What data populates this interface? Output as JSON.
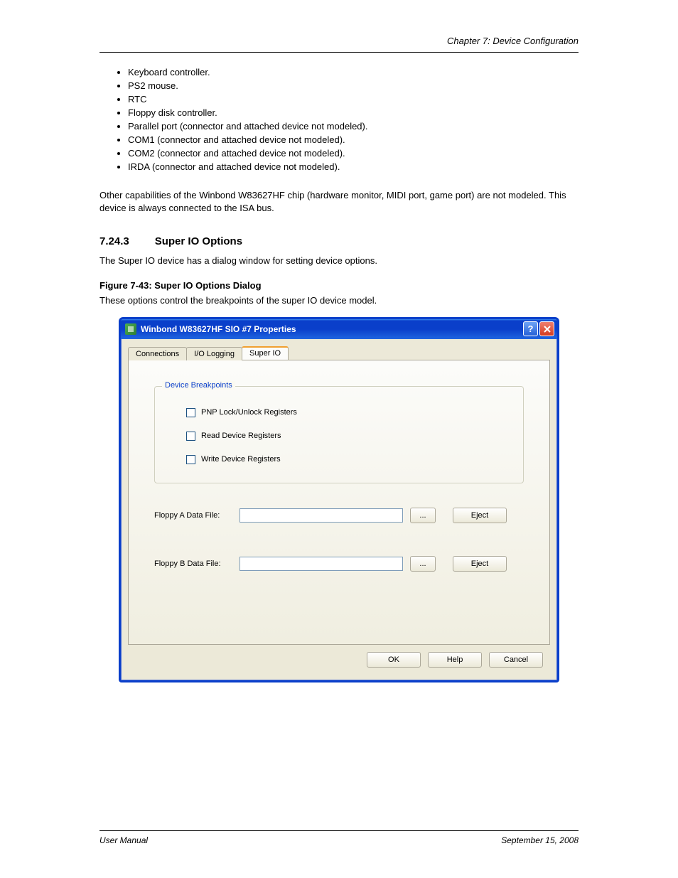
{
  "header_right": "Chapter 7: Device Configuration",
  "bullets": [
    "Keyboard controller.",
    "PS2 mouse.",
    "RTC",
    "Floppy disk controller.",
    "Parallel port (connector and attached device not modeled).",
    "COM1 (connector and attached device not modeled).",
    "COM2 (connector and attached device not modeled).",
    "IRDA (connector and attached device not modeled)."
  ],
  "paragraph1": "Other capabilities of the Winbond W83627HF chip (hardware monitor, MIDI port, game port) are not modeled. This device is always connected to the ISA bus.",
  "section_number": "7.24.3",
  "section_title": "Super IO Options",
  "paragraph2": "The Super IO device has a dialog window for setting device options.",
  "figure_caption": "Figure 7-43: Super IO Options Dialog",
  "figure_sub": "These options control the breakpoints of the super IO device model.",
  "dialog": {
    "title": "Winbond W83627HF SIO #7 Properties",
    "tabs": [
      "Connections",
      "I/O Logging",
      "Super IO"
    ],
    "active_tab": 2,
    "groupbox_title": "Device Breakpoints",
    "checkboxes": [
      {
        "label": "PNP Lock/Unlock Registers",
        "checked": false
      },
      {
        "label": "Read Device Registers",
        "checked": false
      },
      {
        "label": "Write Device Registers",
        "checked": false
      }
    ],
    "file_rows": [
      {
        "label": "Floppy A Data File:",
        "value": "",
        "browse": "...",
        "eject": "Eject"
      },
      {
        "label": "Floppy B Data File:",
        "value": "",
        "browse": "...",
        "eject": "Eject"
      }
    ],
    "buttons": {
      "ok": "OK",
      "help": "Help",
      "cancel": "Cancel"
    }
  },
  "footer_left": "User Manual",
  "footer_right": "September 15, 2008"
}
